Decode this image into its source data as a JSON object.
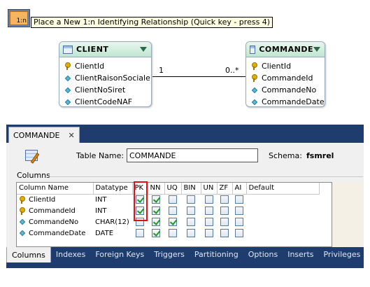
{
  "toolbar": {
    "relationship_button_label": "1:n",
    "tooltip": "Place a New 1:n Identifying Relationship (Quick key - press 4)"
  },
  "diagram": {
    "client": {
      "title": "CLIENT",
      "columns": [
        {
          "name": "ClientId",
          "icon": "primary-key-icon"
        },
        {
          "name": "ClientRaisonSociale",
          "icon": "column-diamond-icon"
        },
        {
          "name": "ClientNoSiret",
          "icon": "column-diamond-icon"
        },
        {
          "name": "ClientCodeNAF",
          "icon": "column-diamond-icon"
        }
      ]
    },
    "commande": {
      "title": "COMMANDE",
      "columns": [
        {
          "name": "ClientId",
          "icon": "primary-key-icon"
        },
        {
          "name": "CommandeId",
          "icon": "primary-key-icon"
        },
        {
          "name": "CommandeNo",
          "icon": "column-diamond-icon"
        },
        {
          "name": "CommandeDate",
          "icon": "column-diamond-icon"
        }
      ]
    },
    "relationship": {
      "left_cardinality": "1",
      "right_cardinality": "0..*"
    }
  },
  "editor": {
    "tab_title": "COMMANDE",
    "tab_close": "✕",
    "table_name_label": "Table Name:",
    "table_name_value": "COMMANDE",
    "schema_label": "Schema:",
    "schema_value": "fsmrel",
    "columns_section": "Columns",
    "grid_headers": [
      "Column Name",
      "Datatype",
      "PK",
      "NN",
      "UQ",
      "BIN",
      "UN",
      "ZF",
      "AI",
      "Default"
    ],
    "rows": [
      {
        "name": "ClientId",
        "type": "INT",
        "key": true,
        "flags": [
          true,
          true,
          false,
          false,
          false,
          false,
          false
        ]
      },
      {
        "name": "CommandeId",
        "type": "INT",
        "key": true,
        "flags": [
          true,
          true,
          false,
          false,
          false,
          false,
          false
        ]
      },
      {
        "name": "CommandeNo",
        "type": "CHAR(12)",
        "key": false,
        "flags": [
          false,
          true,
          true,
          false,
          false,
          false,
          false
        ]
      },
      {
        "name": "CommandeDate",
        "type": "DATE",
        "key": false,
        "flags": [
          false,
          true,
          false,
          false,
          false,
          false,
          false
        ]
      }
    ],
    "bottom_tabs": [
      "Columns",
      "Indexes",
      "Foreign Keys",
      "Triggers",
      "Partitioning",
      "Options",
      "Inserts",
      "Privileges"
    ],
    "active_tab": "Columns"
  },
  "colors": {
    "pk_highlight": "#e0101a",
    "tab_bar": "#1e3c6e",
    "entity_header": "#bfe6d0",
    "checkmark": "#1e9a1e"
  }
}
